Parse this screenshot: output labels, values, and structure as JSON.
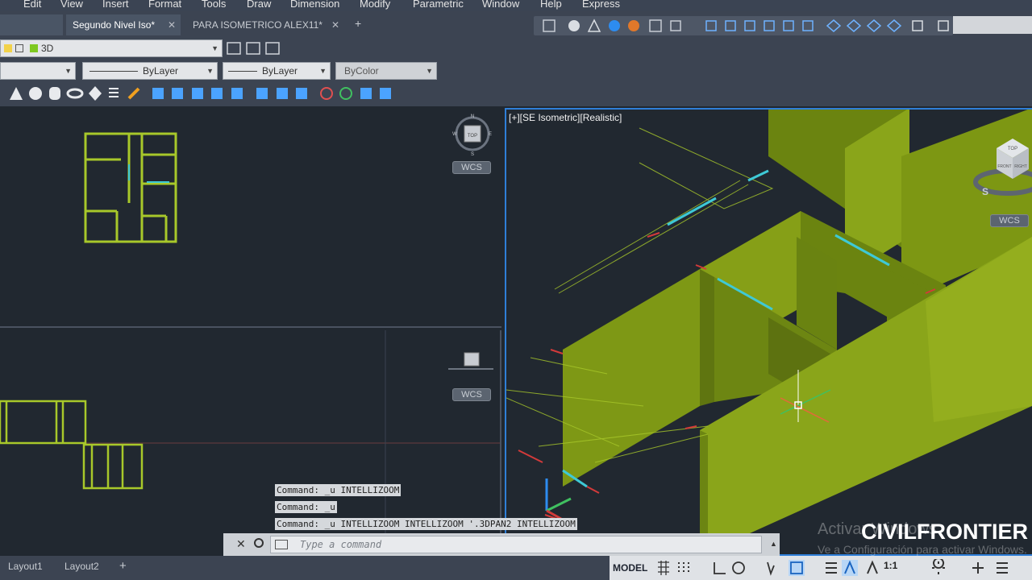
{
  "menu": [
    "Edit",
    "View",
    "Insert",
    "Format",
    "Tools",
    "Draw",
    "Dimension",
    "Modify",
    "Parametric",
    "Window",
    "Help",
    "Express"
  ],
  "tabs": [
    {
      "label": "Segundo Nivel Iso*",
      "active": true
    },
    {
      "label": "PARA ISOMETRICO ALEX11*",
      "active": false
    }
  ],
  "tab_close": "✕",
  "tab_add": "+",
  "layer": {
    "name": "3D"
  },
  "properties": {
    "linetype": "ByLayer",
    "lineweight": "ByLayer",
    "plotstyle": "ByColor"
  },
  "viewports": {
    "active_label": "[+][SE Isometric][Realistic]",
    "wcs_label": "WCS",
    "compass": {
      "n": "N",
      "s": "S",
      "e": "E",
      "w": "W",
      "top": "TOP"
    },
    "viewcube": {
      "top": "TOP",
      "front": "FRONT",
      "right": "RIGHT",
      "s": "S"
    }
  },
  "command_history": [
    "Command: _u INTELLIZOOM",
    "Command: _u",
    "Command: _u INTELLIZOOM INTELLIZOOM '.3DPAN2 INTELLIZOOM"
  ],
  "command_placeholder": "Type a command",
  "layout_tabs": [
    "Layout1",
    "Layout2"
  ],
  "status": {
    "model": "MODEL",
    "scale": "1:1"
  },
  "watermark": {
    "line1": "Activar Windows",
    "line2": "Ve a Configuración para activar Windows."
  },
  "brand": "CIVILFRONTIER",
  "colors": {
    "accent": "#2f7fd8",
    "wall": "#7a9210",
    "plan_line": "#a8c82a",
    "cyan": "#3ec9d6"
  }
}
